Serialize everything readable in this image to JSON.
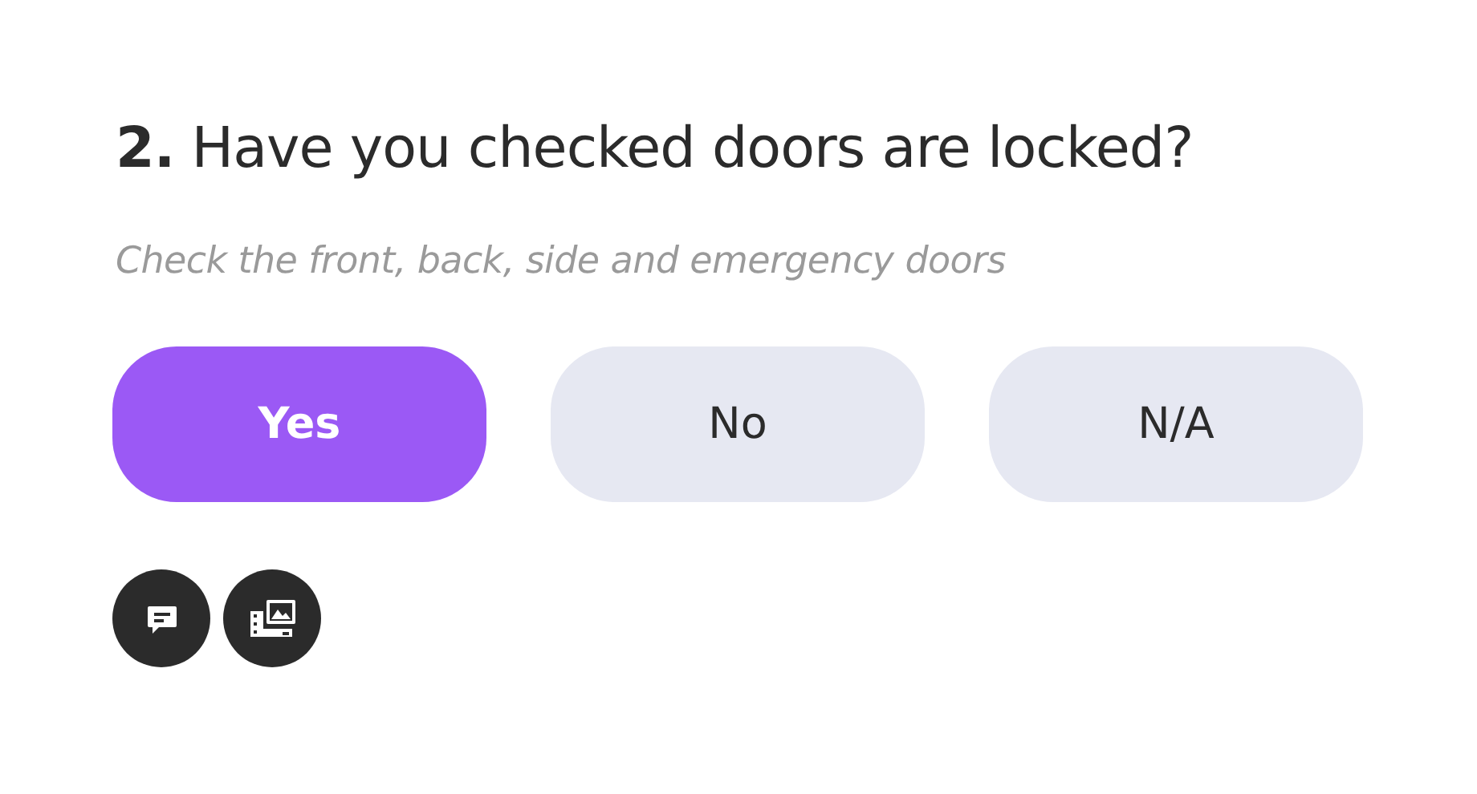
{
  "question": {
    "number": "2.",
    "text": "Have you checked doors are locked?",
    "hint": "Check the front, back, side and emergency doors"
  },
  "options": [
    {
      "label": "Yes",
      "selected": true
    },
    {
      "label": "No",
      "selected": false
    },
    {
      "label": "N/A",
      "selected": false
    }
  ]
}
